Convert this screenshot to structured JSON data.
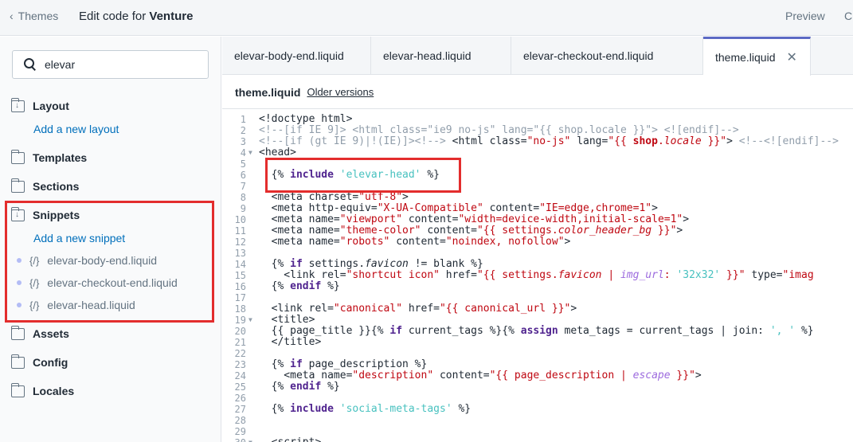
{
  "topbar": {
    "back_label": "Themes",
    "title_prefix": "Edit code for ",
    "theme_name": "Venture",
    "preview_label": "Preview",
    "customize_label": "C"
  },
  "sidebar": {
    "search_value": "elevar",
    "layout": {
      "label": "Layout",
      "add_label": "Add a new layout"
    },
    "templates": {
      "label": "Templates"
    },
    "sections": {
      "label": "Sections"
    },
    "snippets": {
      "label": "Snippets",
      "add_label": "Add a new snippet",
      "files": [
        {
          "prefix": "{/}",
          "name": "elevar-body-end.liquid"
        },
        {
          "prefix": "{/}",
          "name": "elevar-checkout-end.liquid"
        },
        {
          "prefix": "{/}",
          "name": "elevar-head.liquid"
        }
      ]
    },
    "assets": {
      "label": "Assets"
    },
    "config": {
      "label": "Config"
    },
    "locales": {
      "label": "Locales"
    }
  },
  "tabs": [
    {
      "label": "elevar-body-end.liquid"
    },
    {
      "label": "elevar-head.liquid"
    },
    {
      "label": "elevar-checkout-end.liquid"
    },
    {
      "label": "theme.liquid",
      "close": "✕"
    }
  ],
  "file_header": {
    "name": "theme.liquid",
    "older_versions": "Older versions"
  },
  "colors": {
    "accent": "#5c6ac4",
    "link": "#006fbb",
    "highlight_box": "#e32d2d"
  }
}
